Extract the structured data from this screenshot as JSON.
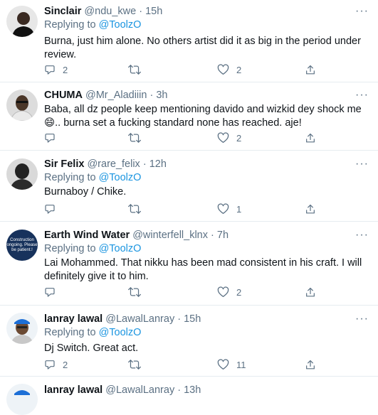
{
  "tweets": [
    {
      "name": "Sinclair",
      "handle": "@ndu_kwe",
      "dot": "·",
      "time": "15h",
      "replying_prefix": "Replying to ",
      "replying_to": "@ToolzO",
      "text": "Burna, just him alone. No others artist did it as big in the period under review.",
      "replies": "2",
      "retweets": "",
      "likes": "2"
    },
    {
      "name": "CHUMA",
      "handle": "@Mr_Aladiiin",
      "dot": "·",
      "time": "3h",
      "replying_prefix": "",
      "replying_to": "",
      "text": "Baba, all dz people keep mentioning davido and wizkid dey shock me😄.. burna set a fucking standard none has reached. aje!",
      "replies": "",
      "retweets": "",
      "likes": "2"
    },
    {
      "name": "Sir Felix",
      "handle": "@rare_felix",
      "dot": "·",
      "time": "12h",
      "replying_prefix": "Replying to ",
      "replying_to": "@ToolzO",
      "text": "Burnaboy / Chike.",
      "replies": "",
      "retweets": "",
      "likes": "1"
    },
    {
      "name": "Earth Wind Water",
      "handle": "@winterfell_klnx",
      "dot": "·",
      "time": "7h",
      "replying_prefix": "Replying to ",
      "replying_to": "@ToolzO",
      "text": "Lai Mohammed. That nikku has been mad consistent in his craft. I will definitely give it to him.",
      "replies": "",
      "retweets": "",
      "likes": "2",
      "avatar_text": "Construction ongoing. Please be patient.!"
    },
    {
      "name": "lanray lawal",
      "handle": "@LawalLanray",
      "dot": "·",
      "time": "15h",
      "replying_prefix": "Replying to ",
      "replying_to": "@ToolzO",
      "text": "Dj Switch. Great act.",
      "replies": "2",
      "retweets": "",
      "likes": "11"
    },
    {
      "name": "lanray lawal",
      "handle": "@LawalLanray",
      "dot": "·",
      "time": "13h",
      "replying_prefix": "",
      "replying_to": "",
      "text": "",
      "replies": "",
      "retweets": "",
      "likes": ""
    }
  ],
  "more_glyph": "···",
  "icons": {
    "reply": "reply-icon",
    "retweet": "retweet-icon",
    "like": "like-icon",
    "share": "share-icon",
    "more": "more-icon"
  },
  "colors": {
    "text": "#0f1419",
    "secondary": "#5b7083",
    "link": "#1b95e0",
    "divider": "#e6ecf0"
  }
}
